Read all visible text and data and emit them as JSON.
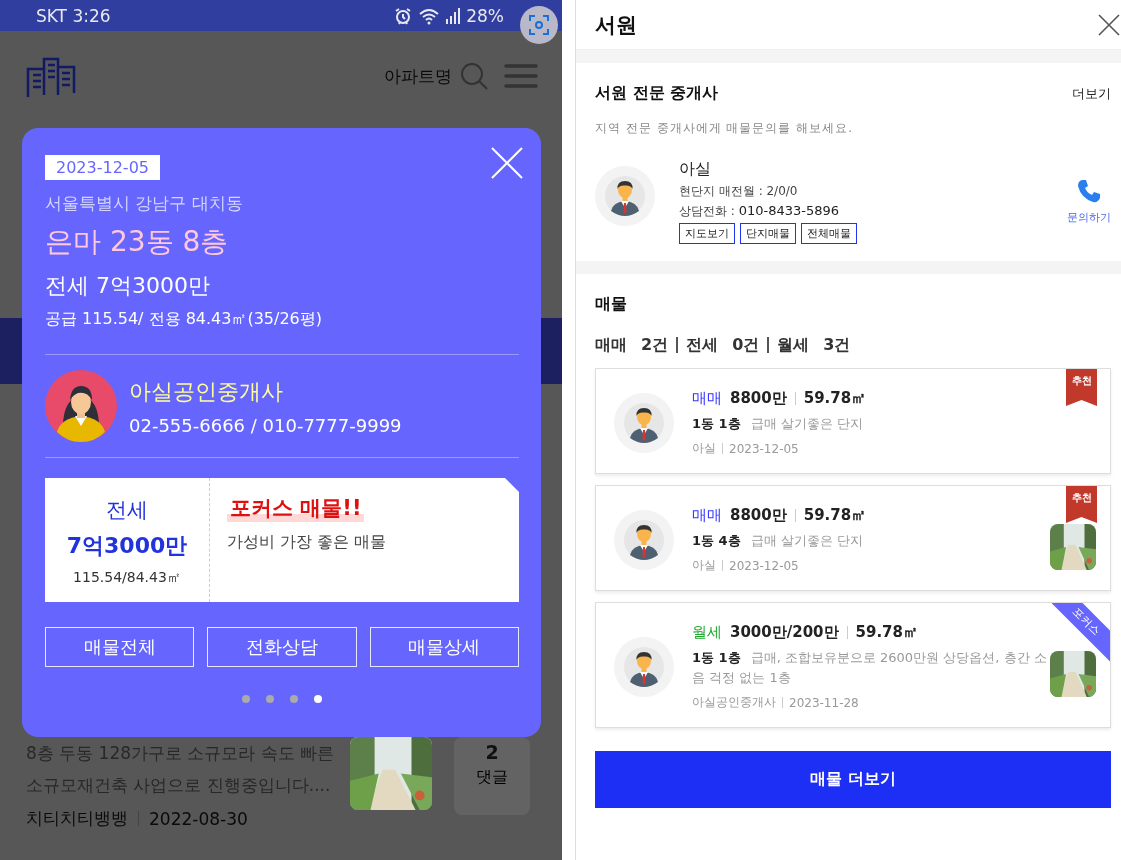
{
  "phone": {
    "status_bar": {
      "carrier_time": "SKT 3:26",
      "battery": "28%"
    },
    "header": {
      "search_placeholder": "아파트명"
    },
    "article": {
      "text": "8층 두동 128가구로 소규모라 속도 빠른 소규모재건축 사업으로 진행중입니다....",
      "author": "치티치티뱅뱅",
      "date": "2022-08-30",
      "comment_count": "2",
      "comment_label": "댓글"
    },
    "modal": {
      "date": "2023-12-05",
      "address": "서울특별시 강남구 대치동",
      "title": "은마 23동 8층",
      "price": "전세 7억3000만",
      "area": "공급 115.54/ 전용 84.43㎡(35/26평)",
      "agent": {
        "name": "아실공인중개사",
        "phones": "02-555-6666 / 010-7777-9999"
      },
      "card": {
        "deal_type": "전세",
        "price": "7억3000만",
        "area": "115.54/84.43㎡",
        "headline": "포커스 매물!!",
        "description": "가성비 가장 좋은 매물"
      },
      "buttons": [
        "매물전체",
        "전화상담",
        "매물상세"
      ],
      "pages": [
        {
          "selected": false
        },
        {
          "selected": false
        },
        {
          "selected": false
        },
        {
          "selected": true
        }
      ]
    }
  },
  "panel": {
    "title": "서원",
    "agents_section": {
      "heading": "서원 전문 중개사",
      "more": "더보기",
      "subtitle": "지역 전문 중개사에게 매물문의를 해보세요.",
      "agent": {
        "name": "아실",
        "stats": "현단지 매전월 : 2/0/0",
        "phone_label": "상담전화 : ",
        "phone": "010-8433-5896",
        "tags": [
          "지도보기",
          "단지매물",
          "전체매물"
        ],
        "contact": "문의하기"
      }
    },
    "listings_section": {
      "heading": "매물",
      "counts": [
        {
          "label": "매매",
          "count": "2건"
        },
        {
          "label": "전세",
          "count": "0건"
        },
        {
          "label": "월세",
          "count": "3건"
        }
      ],
      "listings": [
        {
          "type": "매매",
          "color": "#3333ff",
          "price": "8800만",
          "area": "59.78㎡",
          "unit": "1동 1층",
          "description": "급매 살기좋은 단지",
          "agent": "아실",
          "date": "2023-12-05",
          "badge": {
            "kind": "ribbon",
            "text": "추천"
          },
          "photo": false
        },
        {
          "type": "매매",
          "color": "#3333ff",
          "price": "8800만",
          "area": "59.78㎡",
          "unit": "1동 4층",
          "description": "급매 살기좋은 단지",
          "agent": "아실",
          "date": "2023-12-05",
          "badge": {
            "kind": "ribbon",
            "text": "추천"
          },
          "photo": true
        },
        {
          "type": "월세",
          "color": "#22aa33",
          "price": "3000만/200만",
          "area": "59.78㎡",
          "unit": "1동 1층",
          "description": "급매, 조합보유분으로 2600만원 상당옵션, 층간 소음 걱정 없는 1층",
          "agent": "아실공인중개사",
          "date": "2023-11-28",
          "badge": {
            "kind": "corner",
            "text": "포커스"
          },
          "photo": true
        }
      ],
      "more_button": "매물 더보기"
    }
  }
}
